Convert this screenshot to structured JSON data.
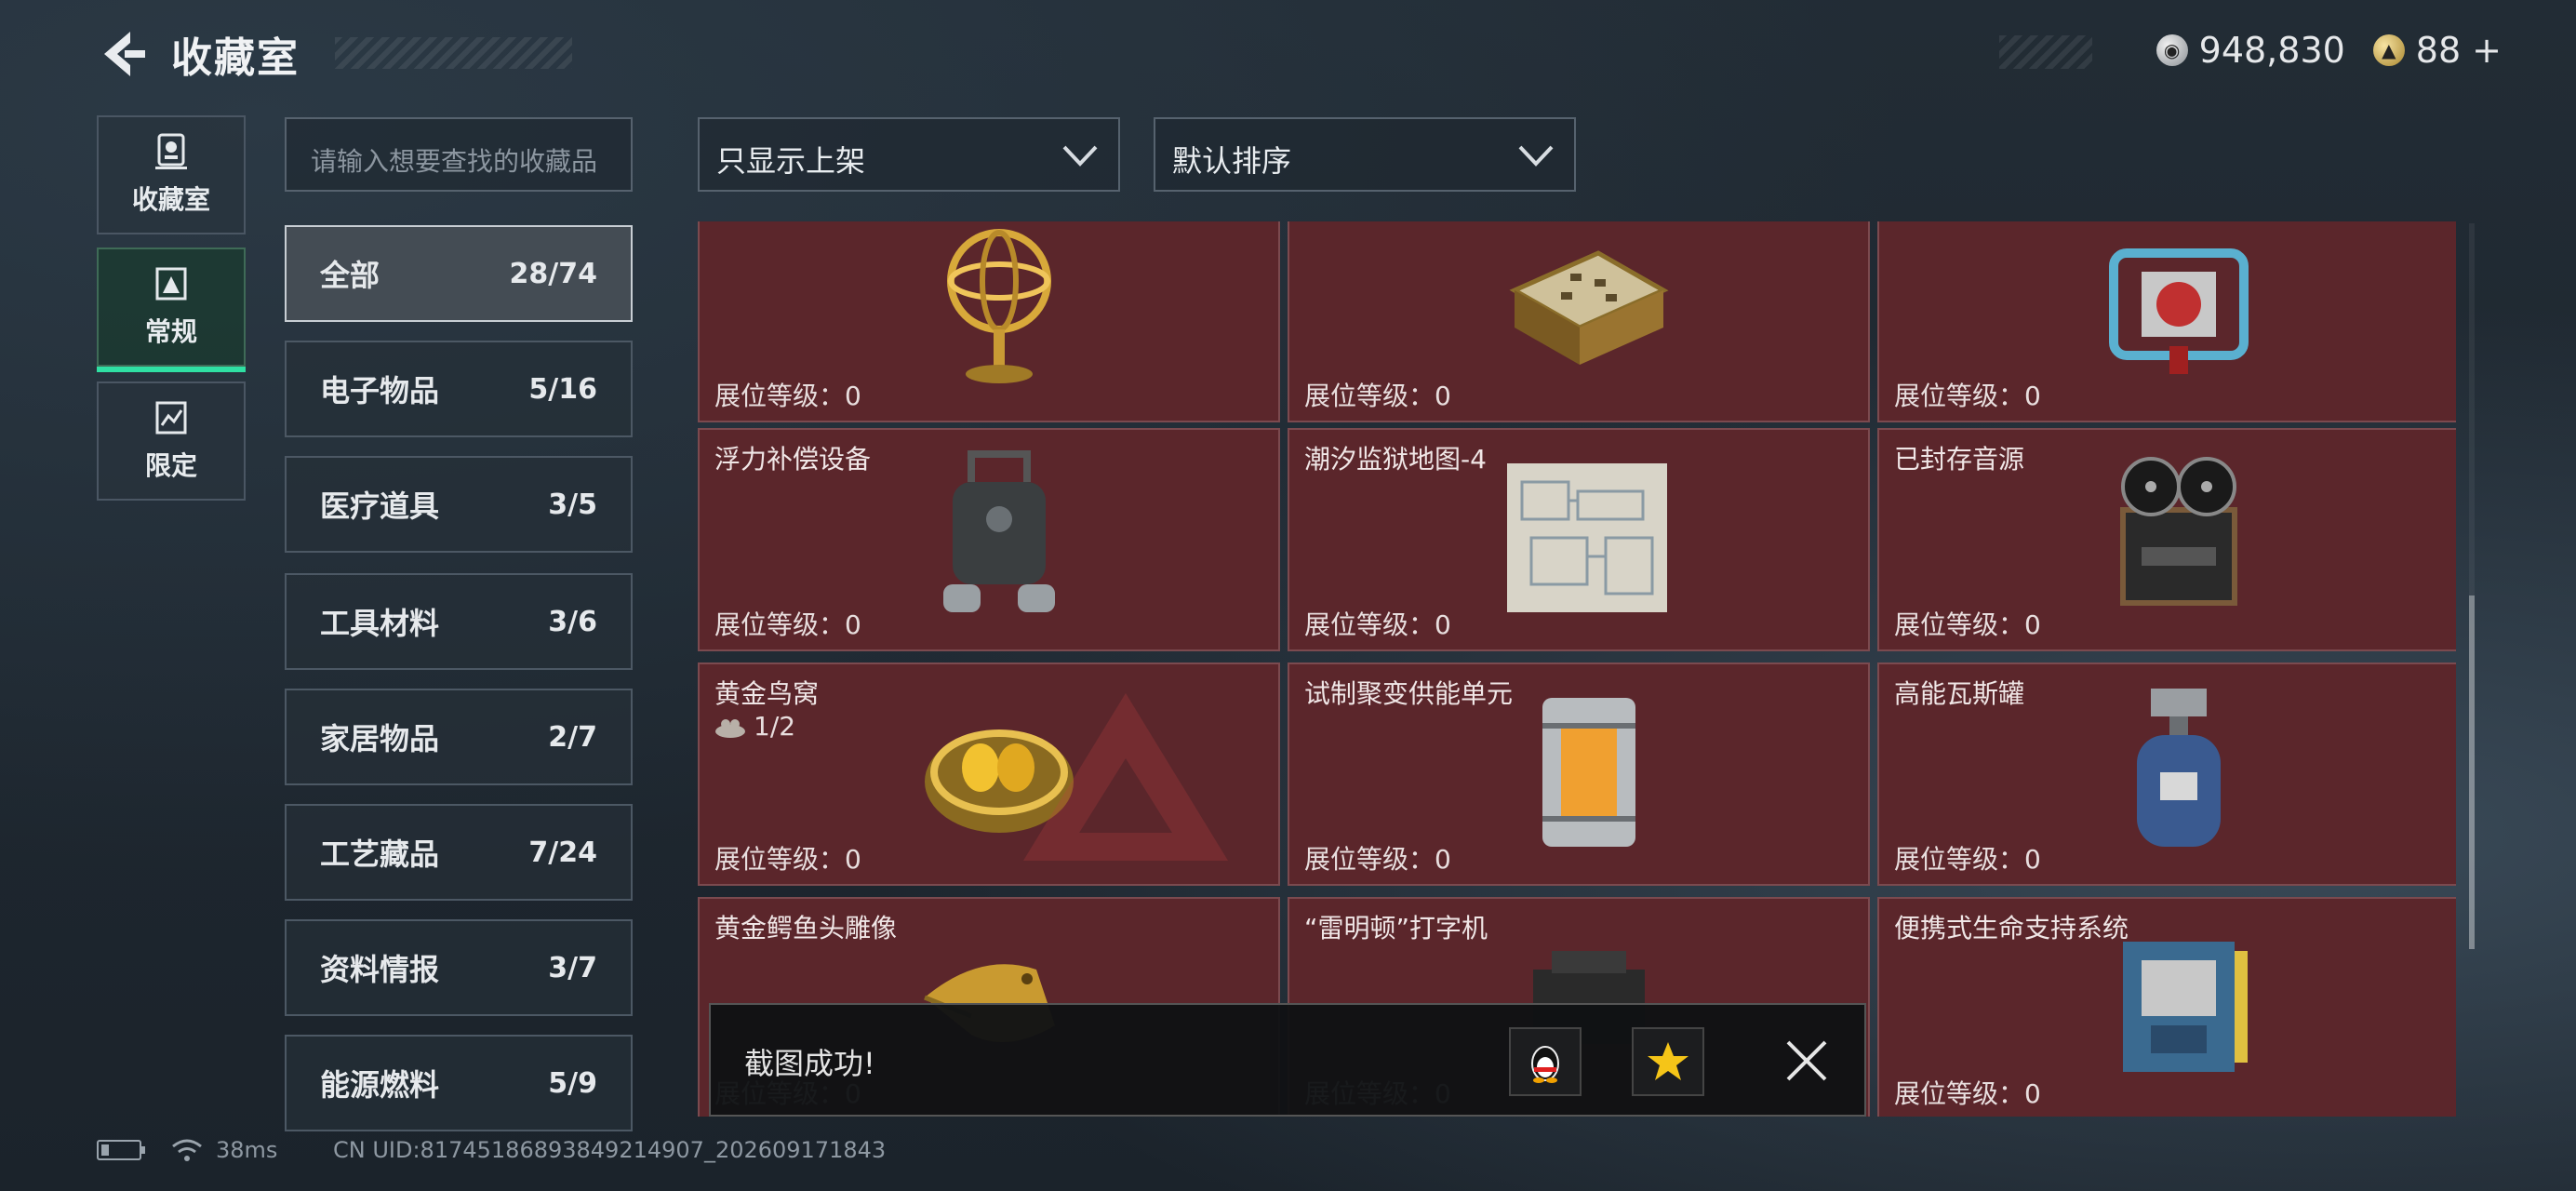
{
  "header": {
    "title": "收藏室",
    "coins": "948,830",
    "tokens": "88",
    "tokens_plus": "+"
  },
  "nav": [
    {
      "label": "收藏室",
      "icon": "trophy-icon"
    },
    {
      "label": "常规",
      "icon": "album-icon",
      "active": true
    },
    {
      "label": "限定",
      "icon": "limited-icon"
    }
  ],
  "search": {
    "placeholder": "请输入想要查找的收藏品"
  },
  "filters": {
    "display": "只显示上架",
    "sort": "默认排序"
  },
  "categories": [
    {
      "name": "全部",
      "count": "28/74",
      "active": true
    },
    {
      "name": "电子物品",
      "count": "5/16"
    },
    {
      "name": "医疗道具",
      "count": "3/5"
    },
    {
      "name": "工具材料",
      "count": "3/6"
    },
    {
      "name": "家居物品",
      "count": "2/7"
    },
    {
      "name": "工艺藏品",
      "count": "7/24"
    },
    {
      "name": "资料情报",
      "count": "3/7"
    },
    {
      "name": "能源燃料",
      "count": "5/9"
    }
  ],
  "level_label": "展位等级：0",
  "items": [
    {
      "name": "",
      "art": "armillary-sphere-icon"
    },
    {
      "name": "",
      "art": "chess-box-icon"
    },
    {
      "name": "",
      "art": "generator-icon"
    },
    {
      "name": "浮力补偿设备",
      "art": "bcd-device-icon"
    },
    {
      "name": "潮汐监狱地图-4",
      "art": "map-icon"
    },
    {
      "name": "已封存音源",
      "art": "reel-recorder-icon"
    },
    {
      "name": "黄金鸟窝",
      "sub": "1/2",
      "art": "golden-nest-icon"
    },
    {
      "name": "试制聚变供能单元",
      "art": "fusion-cell-icon"
    },
    {
      "name": "高能瓦斯罐",
      "art": "gas-canister-icon"
    },
    {
      "name": "黄金鳄鱼头雕像",
      "art": "croc-statue-icon"
    },
    {
      "name": "“雷明顿”打字机",
      "art": "typewriter-icon"
    },
    {
      "name": "便携式生命支持系统",
      "art": "life-support-icon"
    }
  ],
  "toast": {
    "message": "截图成功!"
  },
  "footer": {
    "ping": "38ms",
    "uid": "CN UID:8174518689384921490​7_202609171843"
  },
  "colors": {
    "card_bg": "#5b262b",
    "accent": "#2fe0a3"
  }
}
